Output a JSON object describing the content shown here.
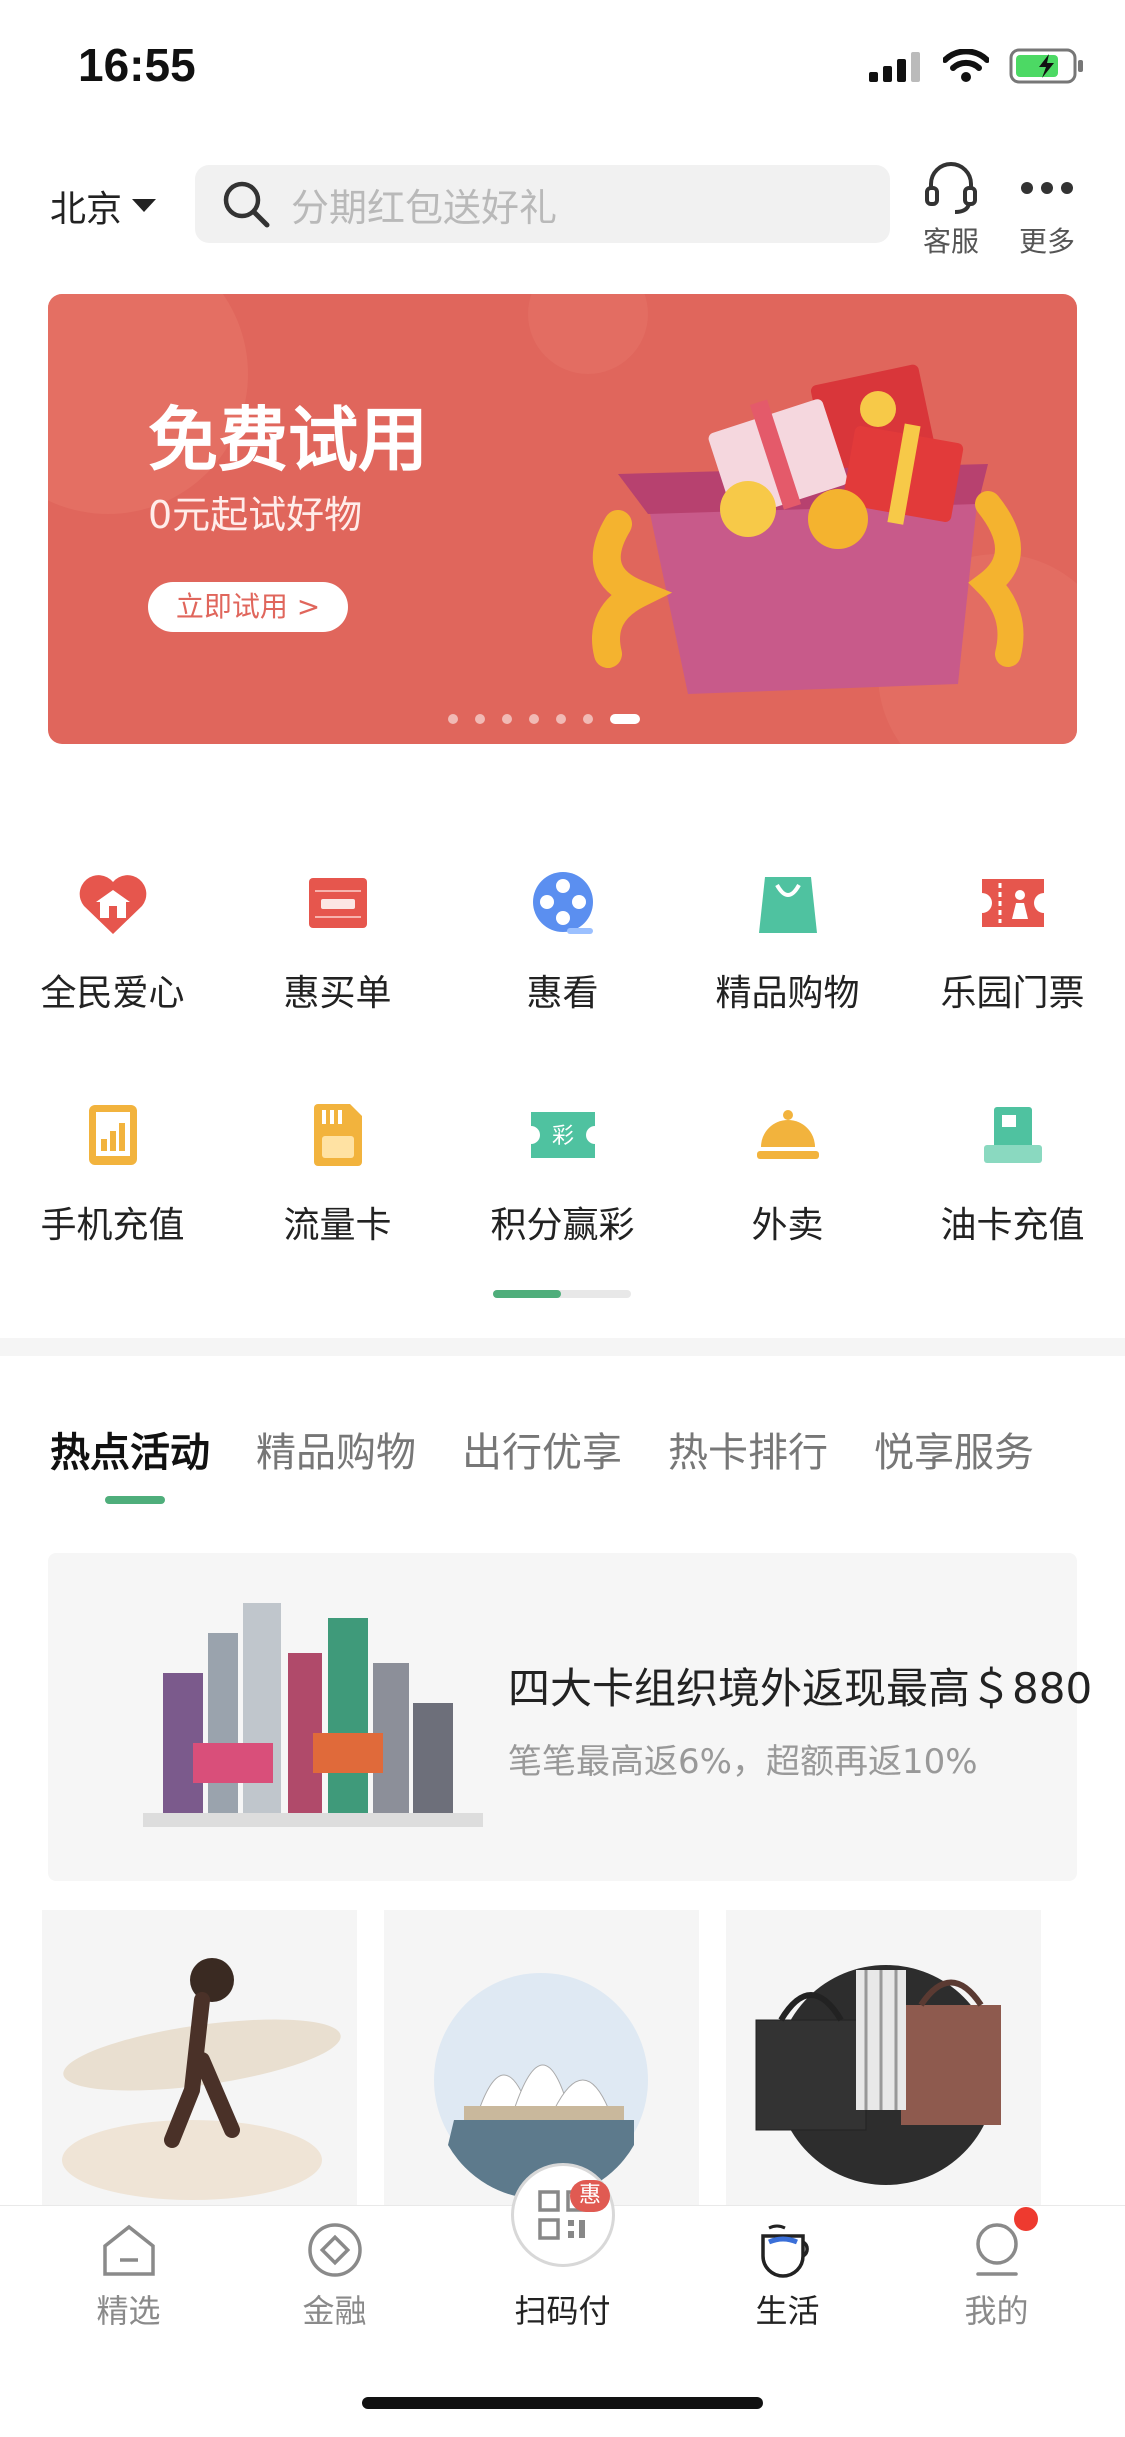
{
  "status": {
    "time": "16:55"
  },
  "header": {
    "city": "北京",
    "search_placeholder": "分期红包送好礼",
    "service_label": "客服",
    "more_label": "更多"
  },
  "banner": {
    "title": "免费试用",
    "subtitle": "0元起试好物",
    "button": "立即试用 >",
    "dots_total": 7,
    "active_dot": 7
  },
  "services": [
    {
      "label": "全民爱心",
      "icon": "heart-home-icon",
      "color": "#e6564d"
    },
    {
      "label": "惠买单",
      "icon": "receipt-icon",
      "color": "#e6564d"
    },
    {
      "label": "惠看",
      "icon": "film-reel-icon",
      "color": "#5b8ff0"
    },
    {
      "label": "精品购物",
      "icon": "shopping-bag-icon",
      "color": "#4fc2a0"
    },
    {
      "label": "乐园门票",
      "icon": "ticket-icon",
      "color": "#e6564d"
    },
    {
      "label": "手机充值",
      "icon": "phone-chart-icon",
      "color": "#f2b33d"
    },
    {
      "label": "流量卡",
      "icon": "sim-card-icon",
      "color": "#f2b33d"
    },
    {
      "label": "积分赢彩",
      "icon": "lottery-ticket-icon",
      "color": "#4fc2a0"
    },
    {
      "label": "外卖",
      "icon": "food-cloche-icon",
      "color": "#f2b33d"
    },
    {
      "label": "油卡充值",
      "icon": "fuel-card-icon",
      "color": "#4fc2a0"
    }
  ],
  "tabs": [
    "热点活动",
    "精品购物",
    "出行优享",
    "热卡排行",
    "悦享服务"
  ],
  "active_tab": 0,
  "promo": {
    "title": "四大卡组织境外返现最高＄880",
    "subtitle": "笔笔最高返6%，超额再返10%"
  },
  "tabbar": {
    "items": [
      "精选",
      "金融",
      "扫码付",
      "生活",
      "我的"
    ],
    "active": 3,
    "scan_badge": "惠"
  },
  "colors": {
    "accent_green": "#4fae7b",
    "banner_red": "#e0665c"
  }
}
